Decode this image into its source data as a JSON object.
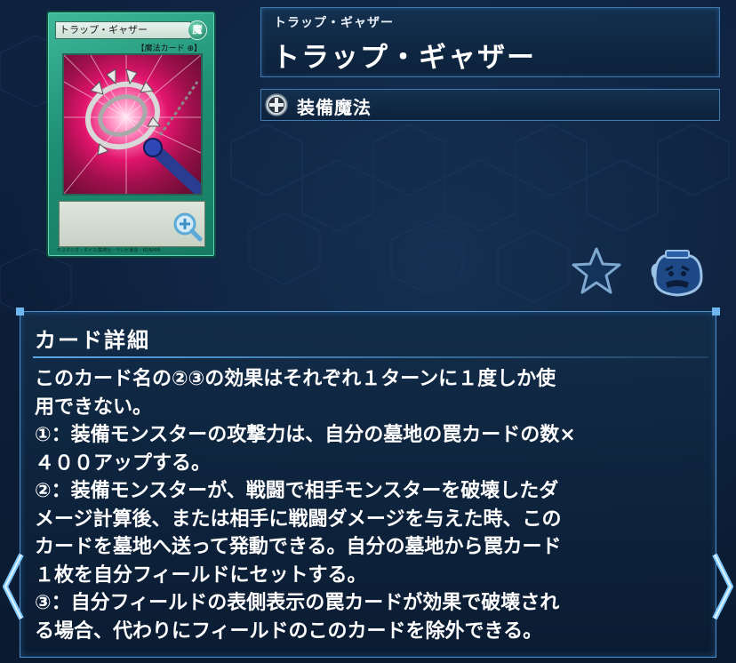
{
  "card": {
    "name_on_card": "トラップ・ギャザー",
    "attribute": "魔",
    "type_line": "【魔法カード",
    "copyright": "©スタジオ・ダイス/集英社・テレビ東京・KONAMI"
  },
  "title": {
    "ruby": "トラップ・ギャザー",
    "name": "トラップ・ギャザー"
  },
  "card_type": {
    "label": "装備魔法",
    "icon": "equip-spell-icon"
  },
  "actions": {
    "favorite_icon": "star-icon",
    "deck_icon": "pot-icon"
  },
  "details": {
    "heading": "カード詳細",
    "lines": [
      "このカード名の②③の効果はそれぞれ１ターンに１度しか使",
      "用できない。",
      "①：装備モンスターの攻撃力は、自分の墓地の罠カードの数×",
      "４００アップする。",
      "②：装備モンスターが、戦闘で相手モンスターを破壊したダ",
      "メージ計算後、または相手に戦闘ダメージを与えた時、この",
      "カードを墓地へ送って発動できる。自分の墓地から罠カード",
      "１枚を自分フィールドにセットする。",
      "③：自分フィールドの表側表示の罠カードが効果で破壊され",
      "る場合、代わりにフィールドのこのカードを除外できる。"
    ]
  },
  "colors": {
    "background": "#0b1a30",
    "panel_border": "#3f7bb0",
    "accent": "#5aa6e6",
    "card_frame": "#1d8f74"
  }
}
